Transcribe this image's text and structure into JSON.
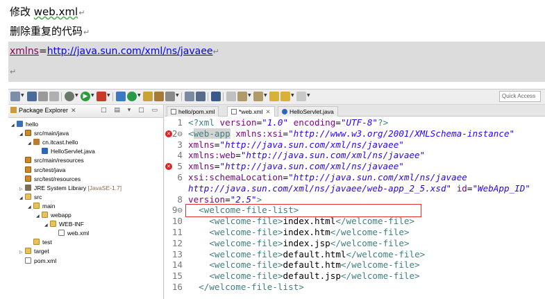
{
  "document": {
    "line1_prefix": "修改 ",
    "line1_file": "web.xml",
    "line2": "删除重复的代码",
    "xmlns_attr": "xmlns",
    "xmlns_eq": "=",
    "xmlns_url": "http://java.sun.com/xml/ns/javaee",
    "para_mark": "↵"
  },
  "toolbar": {
    "quick_access_placeholder": "Quick Access"
  },
  "package_explorer": {
    "title": "Package Explorer",
    "close": "✕",
    "tools": "□ ▤ ▾ □ ▭",
    "tree": [
      {
        "label": "hello",
        "icon": "project-icon",
        "depth": 0,
        "expanded": true
      },
      {
        "label": "src/main/java",
        "icon": "source-folder-icon",
        "depth": 1,
        "expanded": true
      },
      {
        "label": "cn.itcast.hello",
        "icon": "package-icon",
        "depth": 2,
        "expanded": true
      },
      {
        "label": "HelloServlet.java",
        "icon": "java-file-icon",
        "depth": 3,
        "expanded": null
      },
      {
        "label": "src/main/resources",
        "icon": "source-folder-icon",
        "depth": 1,
        "expanded": null
      },
      {
        "label": "src/test/java",
        "icon": "source-folder-icon",
        "depth": 1,
        "expanded": null
      },
      {
        "label": "src/test/resources",
        "icon": "source-folder-icon",
        "depth": 1,
        "expanded": null
      },
      {
        "label": "JRE System Library",
        "suffix": "[JavaSE-1.7]",
        "icon": "library-icon",
        "depth": 1,
        "expanded": false
      },
      {
        "label": "src",
        "icon": "folder-icon",
        "depth": 1,
        "expanded": true
      },
      {
        "label": "main",
        "icon": "folder-icon",
        "depth": 2,
        "expanded": true
      },
      {
        "label": "webapp",
        "icon": "folder-icon",
        "depth": 3,
        "expanded": true
      },
      {
        "label": "WEB-INF",
        "icon": "folder-icon",
        "depth": 4,
        "expanded": true
      },
      {
        "label": "web.xml",
        "icon": "xml-file-icon",
        "depth": 5,
        "expanded": null
      },
      {
        "label": "test",
        "icon": "folder-icon",
        "depth": 2,
        "expanded": null
      },
      {
        "label": "target",
        "icon": "folder-icon",
        "depth": 1,
        "expanded": false
      },
      {
        "label": "pom.xml",
        "icon": "xml-file-icon",
        "depth": 1,
        "expanded": null
      }
    ]
  },
  "editor": {
    "tabs": [
      {
        "label": "hello/pom.xml",
        "icon": "xml-file-icon",
        "active": false
      },
      {
        "label": "*web.xml",
        "icon": "xml-file-icon",
        "active": true
      },
      {
        "label": "HelloServlet.java",
        "icon": "java-file-icon",
        "active": false
      }
    ],
    "tab_close": "✕",
    "lines": [
      {
        "n": "1",
        "segments": [
          [
            "pi",
            "<?xml "
          ],
          [
            "a",
            "version"
          ],
          [
            "txt",
            "="
          ],
          [
            "s",
            "\"1.0\""
          ],
          [
            "a",
            " encoding"
          ],
          [
            "txt",
            "="
          ],
          [
            "s",
            "\"UTF-8\""
          ],
          [
            "pi",
            "?>"
          ]
        ]
      },
      {
        "n": "2",
        "error": true,
        "fold": "⊖",
        "segments": [
          [
            "t",
            "<"
          ],
          [
            "t hl-web",
            "web-app"
          ],
          [
            "a",
            " xmlns:xsi"
          ],
          [
            "txt",
            "="
          ],
          [
            "s",
            "\"http://www.w3.org/2001/XMLSchema-instance\""
          ]
        ]
      },
      {
        "n": "3",
        "segments": [
          [
            "a",
            "xmlns"
          ],
          [
            "txt",
            "="
          ],
          [
            "s",
            "\"http://java.sun.com/xml/ns/javaee\""
          ]
        ]
      },
      {
        "n": "4",
        "segments": [
          [
            "a",
            "xmlns:web"
          ],
          [
            "txt",
            "="
          ],
          [
            "s",
            "\"http://java.sun.com/xml/ns/javaee\""
          ]
        ]
      },
      {
        "n": "5",
        "error": true,
        "segments": [
          [
            "a",
            "xmlns"
          ],
          [
            "txt",
            "="
          ],
          [
            "s",
            "\"http://java.sun.com/xml/ns/javaee\""
          ]
        ]
      },
      {
        "n": "6",
        "segments": [
          [
            "a",
            "xsi:schemaLocation"
          ],
          [
            "txt",
            "="
          ],
          [
            "s",
            "\"http://java.sun.com/xml/ns/javaee"
          ]
        ]
      },
      {
        "n": "",
        "segments": [
          [
            "s",
            "http://java.sun.com/xml/ns/javaee/web-app_2_5.xsd\""
          ],
          [
            "a",
            " id"
          ],
          [
            "txt",
            "="
          ],
          [
            "s",
            "\"WebApp_ID\""
          ]
        ]
      },
      {
        "n": "8",
        "segments": [
          [
            "a",
            "version"
          ],
          [
            "txt",
            "="
          ],
          [
            "s",
            "\"2.5\""
          ],
          [
            "t",
            ">"
          ]
        ]
      },
      {
        "n": "9",
        "fold": "⊖",
        "segments": [
          [
            "txt",
            "  "
          ],
          [
            "t",
            "<welcome-file-list>"
          ]
        ]
      },
      {
        "n": "10",
        "segments": [
          [
            "txt",
            "    "
          ],
          [
            "t",
            "<welcome-file>"
          ],
          [
            "txt",
            "index.html"
          ],
          [
            "t",
            "</welcome-file>"
          ]
        ]
      },
      {
        "n": "11",
        "segments": [
          [
            "txt",
            "    "
          ],
          [
            "t",
            "<welcome-file>"
          ],
          [
            "txt",
            "index.htm"
          ],
          [
            "t",
            "</welcome-file>"
          ]
        ]
      },
      {
        "n": "12",
        "segments": [
          [
            "txt",
            "    "
          ],
          [
            "t",
            "<welcome-file>"
          ],
          [
            "txt",
            "index.jsp"
          ],
          [
            "t",
            "</welcome-file>"
          ]
        ]
      },
      {
        "n": "13",
        "segments": [
          [
            "txt",
            "    "
          ],
          [
            "t",
            "<welcome-file>"
          ],
          [
            "txt",
            "default.html"
          ],
          [
            "t",
            "</welcome-file>"
          ]
        ]
      },
      {
        "n": "14",
        "segments": [
          [
            "txt",
            "    "
          ],
          [
            "t",
            "<welcome-file>"
          ],
          [
            "txt",
            "default.htm"
          ],
          [
            "t",
            "</welcome-file>"
          ]
        ]
      },
      {
        "n": "15",
        "segments": [
          [
            "txt",
            "    "
          ],
          [
            "t",
            "<welcome-file>"
          ],
          [
            "txt",
            "default.jsp"
          ],
          [
            "t",
            "</welcome-file>"
          ]
        ]
      },
      {
        "n": "16",
        "segments": [
          [
            "txt",
            "  "
          ],
          [
            "t",
            "</welcome-file-list>"
          ]
        ]
      }
    ]
  },
  "colors": {
    "tag": "#3f7f7f",
    "attribute": "#7f007f",
    "string": "#2a00ff",
    "error_box": "#e03030",
    "error_marker": "#dd2222"
  }
}
